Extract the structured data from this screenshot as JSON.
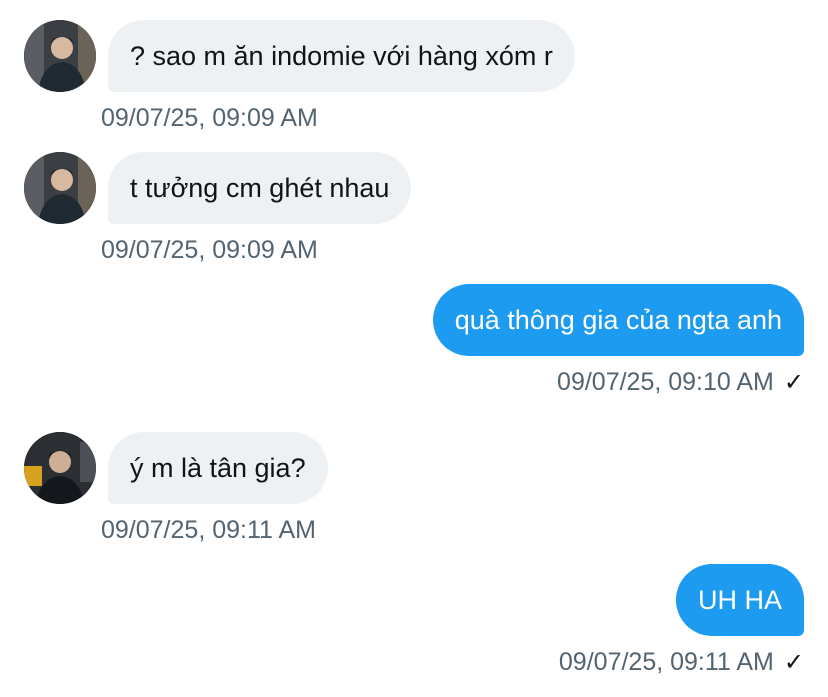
{
  "messages": [
    {
      "direction": "incoming",
      "text": "? sao m ăn indomie với hàng xóm r",
      "timestamp": "09/07/25, 09:09 AM",
      "avatar": "user-photo-avatar"
    },
    {
      "direction": "incoming",
      "text": "t tưởng cm ghét nhau",
      "timestamp": "09/07/25, 09:09 AM",
      "avatar": "user-photo-avatar"
    },
    {
      "direction": "outgoing",
      "text": "quà thông gia của ngta anh",
      "timestamp": "09/07/25, 09:10 AM",
      "status_icon": "✓"
    },
    {
      "direction": "incoming",
      "text": "ý m là tân gia?",
      "timestamp": "09/07/25, 09:11 AM",
      "avatar": "user-photo-avatar"
    },
    {
      "direction": "outgoing",
      "text": "UH HA",
      "timestamp": "09/07/25, 09:11 AM",
      "status_icon": "✓"
    }
  ],
  "colors": {
    "incoming_bubble": "#eef1f4",
    "outgoing_bubble": "#1d9bf0",
    "timestamp": "#536471",
    "text": "#0f1419"
  }
}
